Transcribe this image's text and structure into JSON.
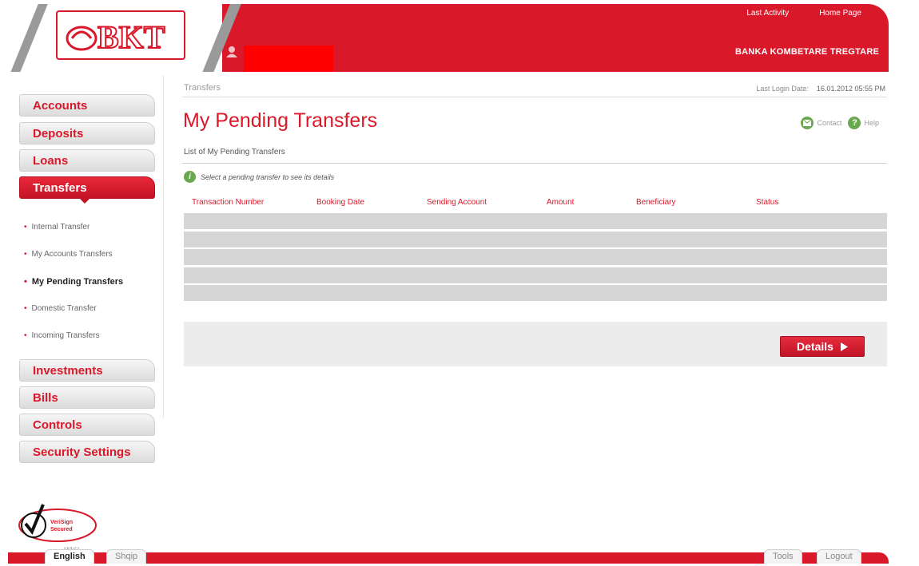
{
  "header": {
    "logo_text": "BKT",
    "top_links": [
      "Last Activity",
      "Home Page"
    ],
    "bank_name": "BANKA KOMBETARE TREGTARE"
  },
  "sidebar": {
    "nav": [
      {
        "label": "Accounts"
      },
      {
        "label": "Deposits"
      },
      {
        "label": "Loans"
      },
      {
        "label": "Transfers",
        "active": true
      },
      {
        "label": "Investments"
      },
      {
        "label": "Bills"
      },
      {
        "label": "Controls"
      },
      {
        "label": "Security Settings"
      }
    ],
    "transfers_submenu": [
      "Internal Transfer",
      "My Accounts Transfers",
      "My Pending Transfers",
      "Domestic Transfer",
      "Incoming Transfers"
    ]
  },
  "main": {
    "breadcrumb": "Transfers",
    "last_login_label": "Last Login Date:",
    "last_login_value": "16.01.2012 05:55 PM",
    "title": "My Pending Transfers",
    "contact_label": "Contact",
    "help_label": "Help",
    "list_title": "List of My Pending Transfers",
    "hint": "Select a pending transfer to see its details",
    "table": {
      "columns": [
        "Transaction Number",
        "Booking Date",
        "Sending Account",
        "Amount",
        "Beneficiary",
        "Status"
      ],
      "rows": [
        [],
        [],
        [],
        [],
        []
      ]
    },
    "details_button": "Details"
  },
  "footer": {
    "languages": [
      "English",
      "Shqip"
    ],
    "tools_label": "Tools",
    "logout_label": "Logout",
    "badge_text": "VeriSign Secured",
    "badge_subtext": "VERIFY"
  },
  "colors": {
    "brand_red": "#d9182a",
    "stripe_gray": "#9a9a9a",
    "row_gray": "#d6d6d6",
    "panel_gray": "#ececec",
    "hint_green": "#6aa84f"
  },
  "icons": {
    "logo": "bkt-logo",
    "user": "user-icon",
    "contact": "contact-icon",
    "help": "help-icon",
    "info": "info-icon",
    "details_arrow": "play-arrow-icon",
    "security_badge": "verisign-checkmark-icon"
  }
}
